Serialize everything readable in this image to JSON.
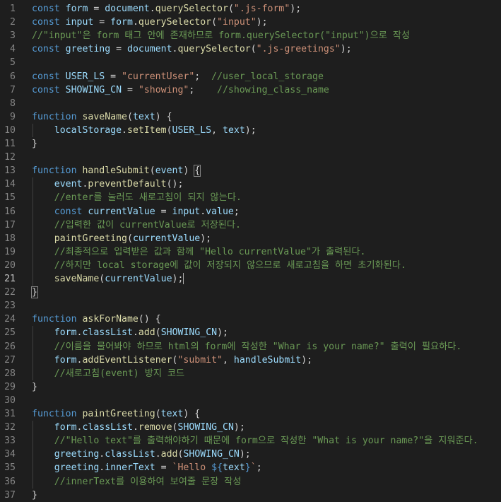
{
  "editor": {
    "active_line": 21,
    "colors": {
      "background": "#1e1e1e",
      "keyword": "#569cd6",
      "variable": "#9cdcfe",
      "function": "#dcdcaa",
      "string": "#ce9178",
      "comment": "#6a9955",
      "text": "#d4d4d4",
      "line_number": "#858585"
    },
    "lines": [
      {
        "n": "1",
        "tokens": [
          {
            "t": "kw",
            "v": "const "
          },
          {
            "t": "var",
            "v": "form"
          },
          {
            "t": "op",
            "v": " = "
          },
          {
            "t": "var",
            "v": "document"
          },
          {
            "t": "op",
            "v": "."
          },
          {
            "t": "fn",
            "v": "querySelector"
          },
          {
            "t": "op",
            "v": "("
          },
          {
            "t": "str",
            "v": "\".js-form\""
          },
          {
            "t": "op",
            "v": ");"
          }
        ]
      },
      {
        "n": "2",
        "tokens": [
          {
            "t": "kw",
            "v": "const "
          },
          {
            "t": "var",
            "v": "input"
          },
          {
            "t": "op",
            "v": " = "
          },
          {
            "t": "var",
            "v": "form"
          },
          {
            "t": "op",
            "v": "."
          },
          {
            "t": "fn",
            "v": "querySelector"
          },
          {
            "t": "op",
            "v": "("
          },
          {
            "t": "str",
            "v": "\"input\""
          },
          {
            "t": "op",
            "v": ");"
          }
        ]
      },
      {
        "n": "3",
        "tokens": [
          {
            "t": "com",
            "v": "//\"input\"은 form 태그 안에 존재하므로 form.querySelector(\"input\")으로 작성"
          }
        ]
      },
      {
        "n": "4",
        "tokens": [
          {
            "t": "kw",
            "v": "const "
          },
          {
            "t": "var",
            "v": "greeting"
          },
          {
            "t": "op",
            "v": " = "
          },
          {
            "t": "var",
            "v": "document"
          },
          {
            "t": "op",
            "v": "."
          },
          {
            "t": "fn",
            "v": "querySelector"
          },
          {
            "t": "op",
            "v": "("
          },
          {
            "t": "str",
            "v": "\".js-greetings\""
          },
          {
            "t": "op",
            "v": ");"
          }
        ]
      },
      {
        "n": "5",
        "tokens": []
      },
      {
        "n": "6",
        "tokens": [
          {
            "t": "kw",
            "v": "const "
          },
          {
            "t": "var",
            "v": "USER_LS"
          },
          {
            "t": "op",
            "v": " = "
          },
          {
            "t": "str",
            "v": "\"currentUser\""
          },
          {
            "t": "op",
            "v": ";  "
          },
          {
            "t": "com",
            "v": "//user_local_storage"
          }
        ]
      },
      {
        "n": "7",
        "tokens": [
          {
            "t": "kw",
            "v": "const "
          },
          {
            "t": "var",
            "v": "SHOWING_CN"
          },
          {
            "t": "op",
            "v": " = "
          },
          {
            "t": "str",
            "v": "\"showing\""
          },
          {
            "t": "op",
            "v": ";    "
          },
          {
            "t": "com",
            "v": "//showing_class_name"
          }
        ]
      },
      {
        "n": "8",
        "tokens": []
      },
      {
        "n": "9",
        "tokens": [
          {
            "t": "kw",
            "v": "function "
          },
          {
            "t": "fn",
            "v": "saveName"
          },
          {
            "t": "op",
            "v": "("
          },
          {
            "t": "var",
            "v": "text"
          },
          {
            "t": "op",
            "v": ") {"
          }
        ]
      },
      {
        "n": "10",
        "tokens": [
          {
            "t": "op",
            "v": "    "
          },
          {
            "t": "var",
            "v": "localStorage"
          },
          {
            "t": "op",
            "v": "."
          },
          {
            "t": "fn",
            "v": "setItem"
          },
          {
            "t": "op",
            "v": "("
          },
          {
            "t": "var",
            "v": "USER_LS"
          },
          {
            "t": "op",
            "v": ", "
          },
          {
            "t": "var",
            "v": "text"
          },
          {
            "t": "op",
            "v": ");"
          }
        ]
      },
      {
        "n": "11",
        "tokens": [
          {
            "t": "op",
            "v": "}"
          }
        ]
      },
      {
        "n": "12",
        "tokens": []
      },
      {
        "n": "13",
        "tokens": [
          {
            "t": "kw",
            "v": "function "
          },
          {
            "t": "fn",
            "v": "handleSubmit"
          },
          {
            "t": "op",
            "v": "("
          },
          {
            "t": "var",
            "v": "event"
          },
          {
            "t": "op",
            "v": ") "
          },
          {
            "t": "brk",
            "v": "{"
          }
        ]
      },
      {
        "n": "14",
        "tokens": [
          {
            "t": "op",
            "v": "    "
          },
          {
            "t": "var",
            "v": "event"
          },
          {
            "t": "op",
            "v": "."
          },
          {
            "t": "fn",
            "v": "preventDefault"
          },
          {
            "t": "op",
            "v": "();"
          }
        ]
      },
      {
        "n": "15",
        "tokens": [
          {
            "t": "op",
            "v": "    "
          },
          {
            "t": "com",
            "v": "//enter를 눌러도 새로고침이 되지 않는다."
          }
        ]
      },
      {
        "n": "16",
        "tokens": [
          {
            "t": "op",
            "v": "    "
          },
          {
            "t": "kw",
            "v": "const "
          },
          {
            "t": "var",
            "v": "currentValue"
          },
          {
            "t": "op",
            "v": " = "
          },
          {
            "t": "var",
            "v": "input"
          },
          {
            "t": "op",
            "v": "."
          },
          {
            "t": "var",
            "v": "value"
          },
          {
            "t": "op",
            "v": ";"
          }
        ]
      },
      {
        "n": "17",
        "tokens": [
          {
            "t": "op",
            "v": "    "
          },
          {
            "t": "com",
            "v": "//입력한 값이 currentValue로 저장된다."
          }
        ]
      },
      {
        "n": "18",
        "tokens": [
          {
            "t": "op",
            "v": "    "
          },
          {
            "t": "fn",
            "v": "paintGreeting"
          },
          {
            "t": "op",
            "v": "("
          },
          {
            "t": "var",
            "v": "currentValue"
          },
          {
            "t": "op",
            "v": ");"
          }
        ]
      },
      {
        "n": "19",
        "tokens": [
          {
            "t": "op",
            "v": "    "
          },
          {
            "t": "com",
            "v": "//최종적으로 입력받은 값과 함께 \"Hello currentValue\"가 출력된다."
          }
        ]
      },
      {
        "n": "20",
        "tokens": [
          {
            "t": "op",
            "v": "    "
          },
          {
            "t": "com",
            "v": "//하지만 local storage에 값이 저장되지 않으므로 새로고침을 하면 초기화된다."
          }
        ]
      },
      {
        "n": "21",
        "tokens": [
          {
            "t": "op",
            "v": "    "
          },
          {
            "t": "fn",
            "v": "saveName"
          },
          {
            "t": "op",
            "v": "("
          },
          {
            "t": "var",
            "v": "currentValue"
          },
          {
            "t": "op",
            "v": ");"
          },
          {
            "t": "cursor",
            "v": ""
          }
        ]
      },
      {
        "n": "22",
        "tokens": [
          {
            "t": "brk",
            "v": "}"
          }
        ]
      },
      {
        "n": "23",
        "tokens": []
      },
      {
        "n": "24",
        "tokens": [
          {
            "t": "kw",
            "v": "function "
          },
          {
            "t": "fn",
            "v": "askForName"
          },
          {
            "t": "op",
            "v": "() {"
          }
        ]
      },
      {
        "n": "25",
        "tokens": [
          {
            "t": "op",
            "v": "    "
          },
          {
            "t": "var",
            "v": "form"
          },
          {
            "t": "op",
            "v": "."
          },
          {
            "t": "var",
            "v": "classList"
          },
          {
            "t": "op",
            "v": "."
          },
          {
            "t": "fn",
            "v": "add"
          },
          {
            "t": "op",
            "v": "("
          },
          {
            "t": "var",
            "v": "SHOWING_CN"
          },
          {
            "t": "op",
            "v": ");"
          }
        ]
      },
      {
        "n": "26",
        "tokens": [
          {
            "t": "op",
            "v": "    "
          },
          {
            "t": "com",
            "v": "//이름을 물어봐야 하므로 html의 form에 작성한 \"Whar is your name?\" 출력이 필요하다."
          }
        ]
      },
      {
        "n": "27",
        "tokens": [
          {
            "t": "op",
            "v": "    "
          },
          {
            "t": "var",
            "v": "form"
          },
          {
            "t": "op",
            "v": "."
          },
          {
            "t": "fn",
            "v": "addEventListener"
          },
          {
            "t": "op",
            "v": "("
          },
          {
            "t": "str",
            "v": "\"submit\""
          },
          {
            "t": "op",
            "v": ", "
          },
          {
            "t": "var",
            "v": "handleSubmit"
          },
          {
            "t": "op",
            "v": ");"
          }
        ]
      },
      {
        "n": "28",
        "tokens": [
          {
            "t": "op",
            "v": "    "
          },
          {
            "t": "com",
            "v": "//새로고침(event) 방지 코드"
          }
        ]
      },
      {
        "n": "29",
        "tokens": [
          {
            "t": "op",
            "v": "}"
          }
        ]
      },
      {
        "n": "30",
        "tokens": []
      },
      {
        "n": "31",
        "tokens": [
          {
            "t": "kw",
            "v": "function "
          },
          {
            "t": "fn",
            "v": "paintGreeting"
          },
          {
            "t": "op",
            "v": "("
          },
          {
            "t": "var",
            "v": "text"
          },
          {
            "t": "op",
            "v": ") {"
          }
        ]
      },
      {
        "n": "32",
        "tokens": [
          {
            "t": "op",
            "v": "    "
          },
          {
            "t": "var",
            "v": "form"
          },
          {
            "t": "op",
            "v": "."
          },
          {
            "t": "var",
            "v": "classList"
          },
          {
            "t": "op",
            "v": "."
          },
          {
            "t": "fn",
            "v": "remove"
          },
          {
            "t": "op",
            "v": "("
          },
          {
            "t": "var",
            "v": "SHOWING_CN"
          },
          {
            "t": "op",
            "v": ");"
          }
        ]
      },
      {
        "n": "33",
        "tokens": [
          {
            "t": "op",
            "v": "    "
          },
          {
            "t": "com",
            "v": "//\"Hello text\"를 출력해야하기 때문에 form으로 작성한 \"What is your name?\"을 지워준다."
          }
        ]
      },
      {
        "n": "34",
        "tokens": [
          {
            "t": "op",
            "v": "    "
          },
          {
            "t": "var",
            "v": "greeting"
          },
          {
            "t": "op",
            "v": "."
          },
          {
            "t": "var",
            "v": "classList"
          },
          {
            "t": "op",
            "v": "."
          },
          {
            "t": "fn",
            "v": "add"
          },
          {
            "t": "op",
            "v": "("
          },
          {
            "t": "var",
            "v": "SHOWING_CN"
          },
          {
            "t": "op",
            "v": ");"
          }
        ]
      },
      {
        "n": "35",
        "tokens": [
          {
            "t": "op",
            "v": "    "
          },
          {
            "t": "var",
            "v": "greeting"
          },
          {
            "t": "op",
            "v": "."
          },
          {
            "t": "var",
            "v": "innerText"
          },
          {
            "t": "op",
            "v": " = "
          },
          {
            "t": "str",
            "v": "`Hello "
          },
          {
            "t": "kw",
            "v": "${"
          },
          {
            "t": "var",
            "v": "text"
          },
          {
            "t": "kw",
            "v": "}"
          },
          {
            "t": "str",
            "v": "`"
          },
          {
            "t": "op",
            "v": ";"
          }
        ]
      },
      {
        "n": "36",
        "tokens": [
          {
            "t": "op",
            "v": "    "
          },
          {
            "t": "com",
            "v": "//innerText를 이용하여 보여줄 문장 작성"
          }
        ]
      },
      {
        "n": "37",
        "tokens": [
          {
            "t": "op",
            "v": "}"
          }
        ]
      }
    ]
  }
}
